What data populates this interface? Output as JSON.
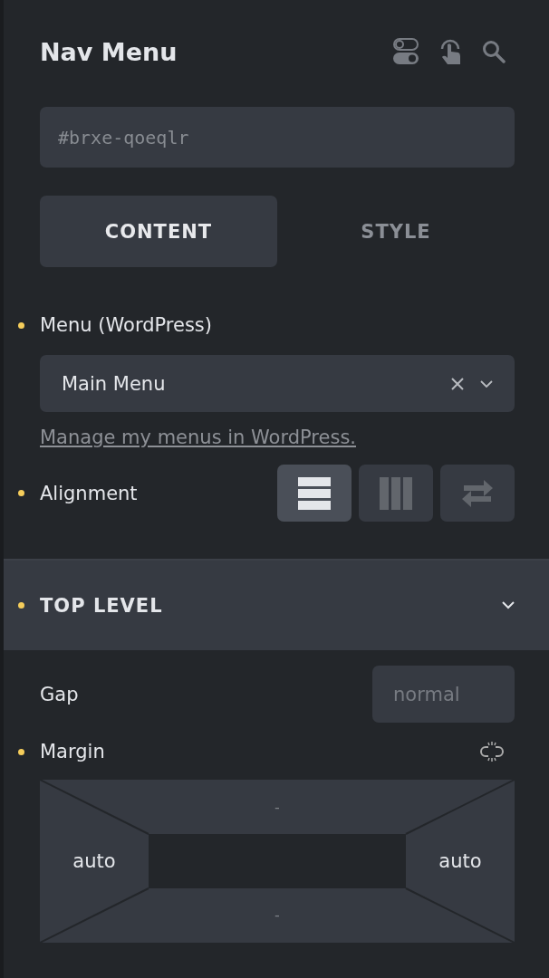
{
  "panel": {
    "title": "Nav Menu"
  },
  "id_field": {
    "placeholder": "#brxe-qoeqlr"
  },
  "tabs": [
    {
      "label": "CONTENT",
      "selected": true
    },
    {
      "label": "STYLE",
      "selected": false
    }
  ],
  "menu_control": {
    "label": "Menu (WordPress)",
    "modified": true,
    "value": "Main Menu",
    "link": "Manage my menus in WordPress."
  },
  "alignment": {
    "label": "Alignment",
    "modified": true,
    "options": [
      {
        "kind": "rows",
        "selected": true
      },
      {
        "kind": "columns",
        "selected": false
      },
      {
        "kind": "swap",
        "selected": false
      }
    ]
  },
  "section": {
    "title": "TOP LEVEL",
    "modified": true,
    "expanded": true
  },
  "gap": {
    "label": "Gap",
    "modified": false,
    "placeholder": "normal"
  },
  "margin": {
    "label": "Margin",
    "modified": true,
    "top": "-",
    "right": "auto",
    "bottom": "-",
    "left": "auto"
  }
}
